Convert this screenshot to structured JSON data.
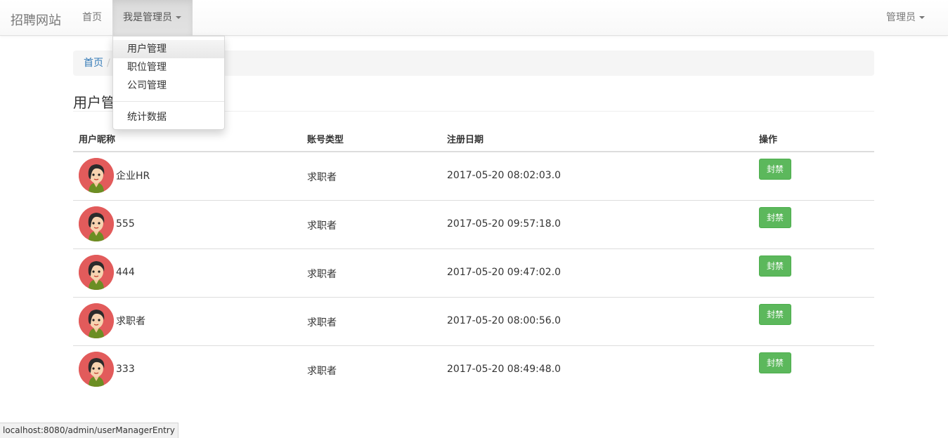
{
  "nav": {
    "brand": "招聘网站",
    "home": "首页",
    "admin_menu": "我是管理员",
    "user_menu": "管理员"
  },
  "dropdown": {
    "items": [
      "用户管理",
      "职位管理",
      "公司管理"
    ],
    "stats": "统计数据"
  },
  "breadcrumb": {
    "home": "首页",
    "separator": "/"
  },
  "page": {
    "title": "用户管理"
  },
  "table": {
    "headers": [
      "用户昵称",
      "账号类型",
      "注册日期",
      "操作"
    ],
    "rows": [
      {
        "name": "企业HR",
        "type": "求职者",
        "date": "2017-05-20 08:02:03.0",
        "action": "封禁"
      },
      {
        "name": "555",
        "type": "求职者",
        "date": "2017-05-20 09:57:18.0",
        "action": "封禁"
      },
      {
        "name": "444",
        "type": "求职者",
        "date": "2017-05-20 09:47:02.0",
        "action": "封禁"
      },
      {
        "name": "求职者",
        "type": "求职者",
        "date": "2017-05-20 08:00:56.0",
        "action": "封禁"
      },
      {
        "name": "333",
        "type": "求职者",
        "date": "2017-05-20 08:49:48.0",
        "action": "封禁"
      }
    ]
  },
  "statusbar": {
    "url": "localhost:8080/admin/userManagerEntry"
  },
  "colors": {
    "avatar_bg": "#e25b5b",
    "ban_button": "#5cb85c",
    "link": "#337ab7"
  },
  "icons": {
    "avatar": "user-avatar-icon",
    "caret": "caret-down-icon"
  }
}
